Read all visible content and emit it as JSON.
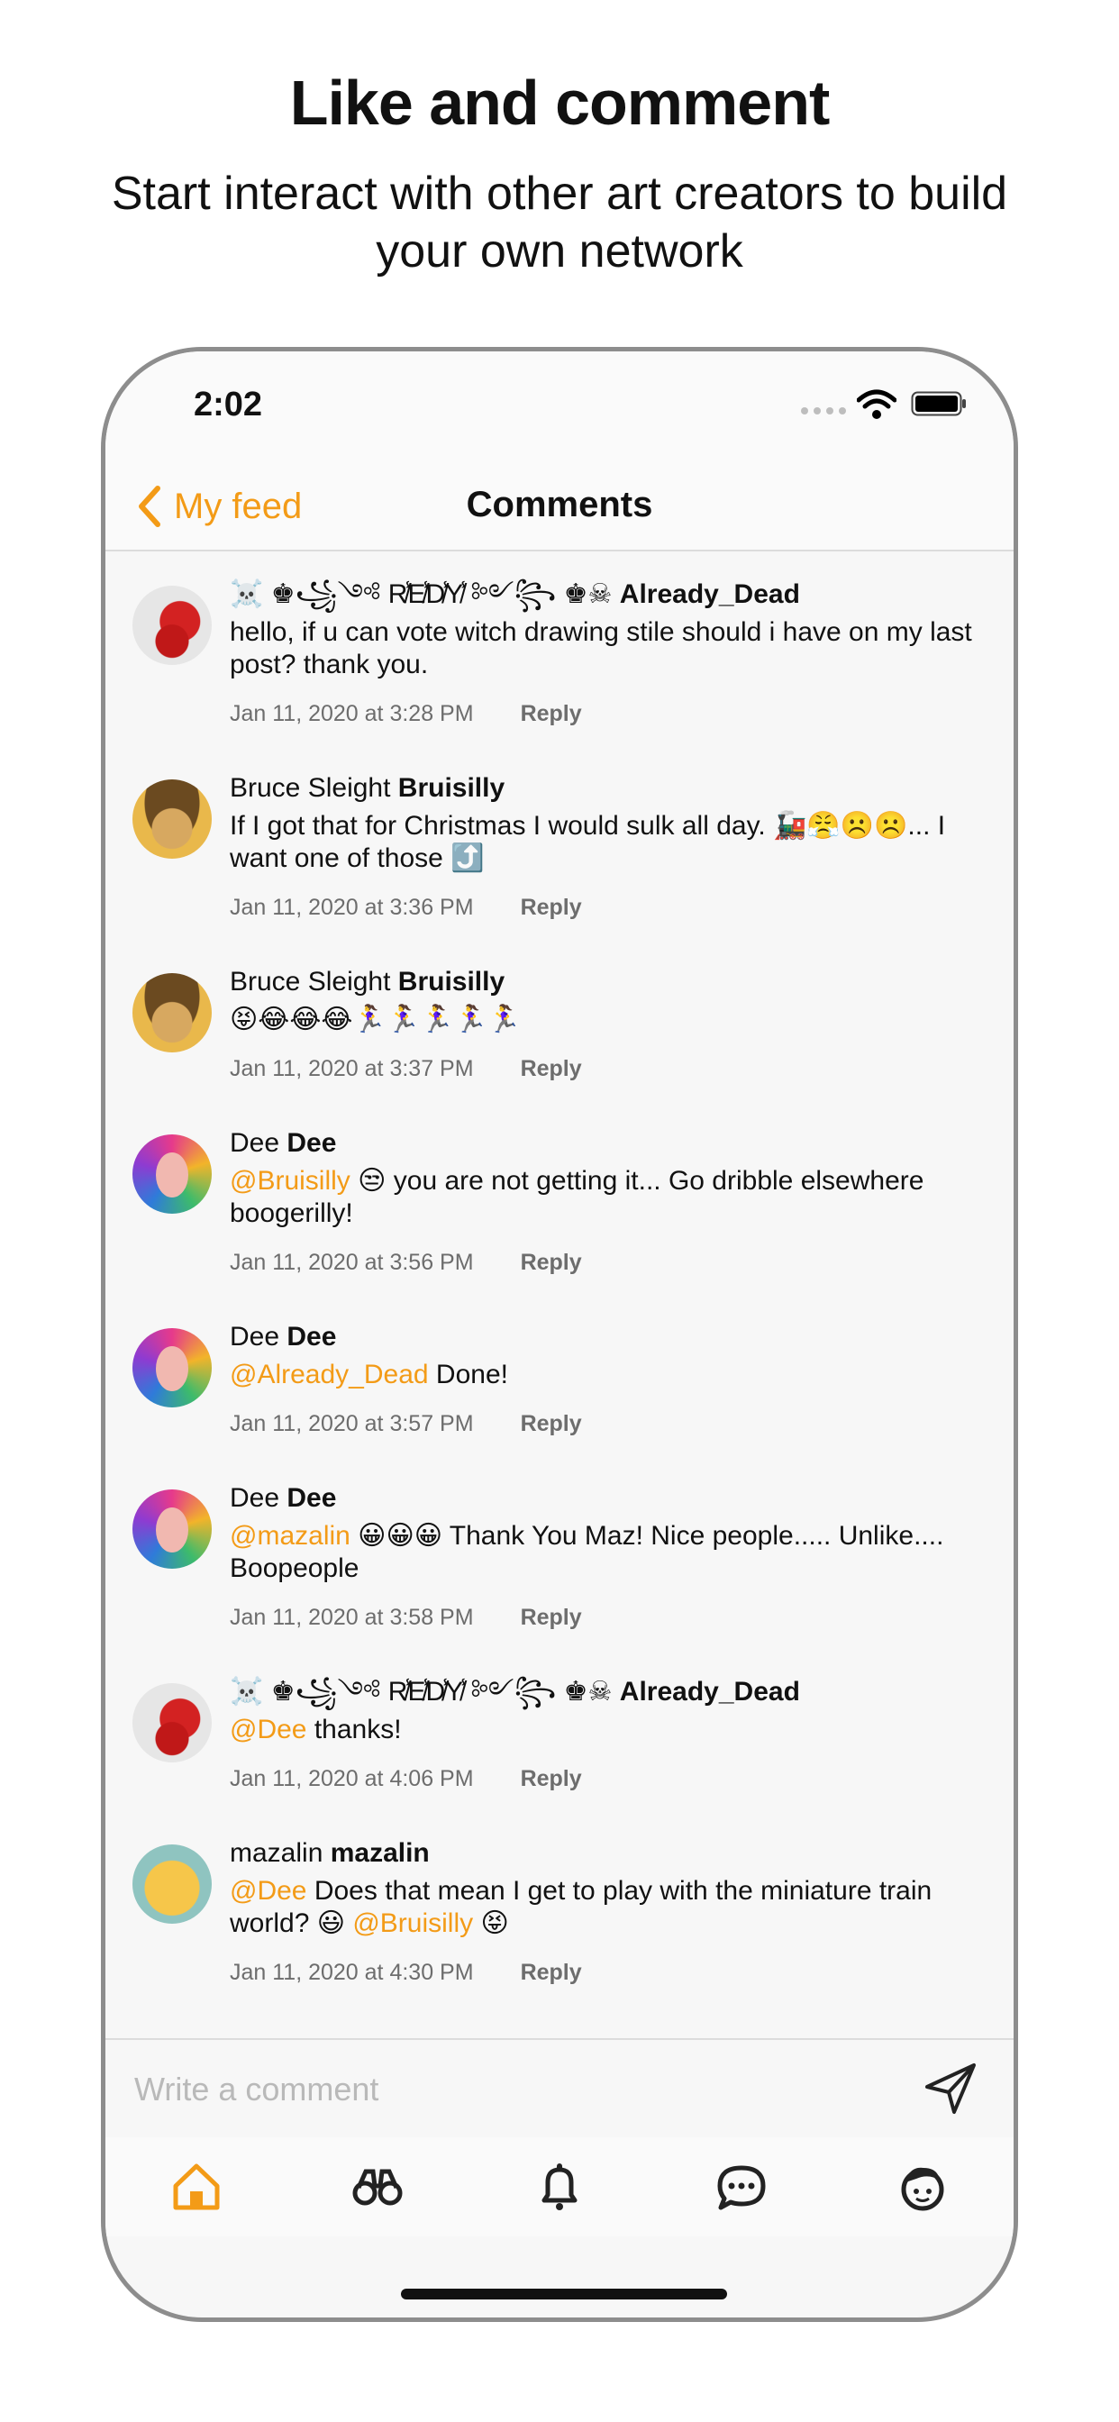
{
  "promo": {
    "headline": "Like and comment",
    "subline": "Start interact with other art creators to build your own network"
  },
  "status_bar": {
    "time": "2:02"
  },
  "nav": {
    "back_label": "My feed",
    "title": "Comments"
  },
  "comments": [
    {
      "display_name": "☠️ ♚꧁༺ R̸̾E̸̾D̸̾Y̸̾ ༻꧂ ♚☠",
      "username": "Already_Dead",
      "parts": [
        {
          "t": "hello, if u can vote witch drawing stile should i have on my last post? thank you.",
          "m": false
        }
      ],
      "time": "Jan 11, 2020 at 3:28 PM",
      "reply": "Reply",
      "avatar": "dead"
    },
    {
      "display_name": "Bruce Sleight",
      "username": "Bruisilly",
      "parts": [
        {
          "t": "If I got that for Christmas I would sulk all day. 🚂😤☹️☹️... I want one of those ⤴️",
          "m": false
        }
      ],
      "time": "Jan 11, 2020 at 3:36 PM",
      "reply": "Reply",
      "avatar": "bruce"
    },
    {
      "display_name": "Bruce Sleight",
      "username": "Bruisilly",
      "parts": [
        {
          "t": "😝😂😂😂🏃‍♀️🏃‍♀️🏃‍♀️🏃‍♀️🏃‍♀️",
          "m": false
        }
      ],
      "time": "Jan 11, 2020 at 3:37 PM",
      "reply": "Reply",
      "avatar": "bruce"
    },
    {
      "display_name": "Dee",
      "username": "Dee",
      "parts": [
        {
          "t": "@Bruisilly",
          "m": true
        },
        {
          "t": " 😒 you are not getting it... Go dribble elsewhere boogerilly!",
          "m": false
        }
      ],
      "time": "Jan 11, 2020 at 3:56 PM",
      "reply": "Reply",
      "avatar": "dee"
    },
    {
      "display_name": "Dee",
      "username": "Dee",
      "parts": [
        {
          "t": "@Already_Dead",
          "m": true
        },
        {
          "t": " Done!",
          "m": false
        }
      ],
      "time": "Jan 11, 2020 at 3:57 PM",
      "reply": "Reply",
      "avatar": "dee"
    },
    {
      "display_name": "Dee",
      "username": "Dee",
      "parts": [
        {
          "t": "@mazalin",
          "m": true
        },
        {
          "t": " 😀😀😀 Thank You Maz! Nice people..... Unlike.... Boopeople",
          "m": false
        }
      ],
      "time": "Jan 11, 2020 at 3:58 PM",
      "reply": "Reply",
      "avatar": "dee"
    },
    {
      "display_name": "☠️ ♚꧁༺ R̸̾E̸̾D̸̾Y̸̾ ༻꧂ ♚☠",
      "username": "Already_Dead",
      "parts": [
        {
          "t": "@Dee",
          "m": true
        },
        {
          "t": " thanks!",
          "m": false
        }
      ],
      "time": "Jan 11, 2020 at 4:06 PM",
      "reply": "Reply",
      "avatar": "dead"
    },
    {
      "display_name": "mazalin",
      "username": "mazalin",
      "parts": [
        {
          "t": "@Dee",
          "m": true
        },
        {
          "t": " Does that mean I get to play with the miniature train world? 😃 ",
          "m": false
        },
        {
          "t": "@Bruisilly",
          "m": true
        },
        {
          "t": " 😝",
          "m": false
        }
      ],
      "time": "Jan 11, 2020 at 4:30 PM",
      "reply": "Reply",
      "avatar": "maz"
    }
  ],
  "composer": {
    "placeholder": "Write a comment"
  },
  "tabs": [
    {
      "icon": "home-icon",
      "active": true
    },
    {
      "icon": "binoculars-icon",
      "active": false
    },
    {
      "icon": "bell-icon",
      "active": false
    },
    {
      "icon": "chat-bubble-icon",
      "active": false
    },
    {
      "icon": "profile-icon",
      "active": false
    }
  ],
  "colors": {
    "accent": "#f39b17",
    "text": "#111111",
    "muted": "#6d6d6d",
    "background": "#f7f7f7"
  }
}
